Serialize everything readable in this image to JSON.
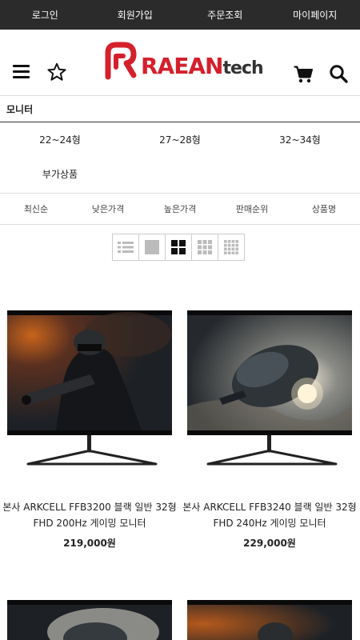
{
  "topbar": {
    "login": "로그인",
    "join": "회원가입",
    "order": "주문조회",
    "mypage": "마이페이지"
  },
  "logo": {
    "main": "RAEAN",
    "sub": "tech"
  },
  "icons": {
    "menu": "hamburger-menu-icon",
    "favorite": "star-icon",
    "cart": "cart-icon",
    "search": "search-icon"
  },
  "category": {
    "title": "모니터",
    "subcategories": [
      "22~24형",
      "27~28형",
      "32~34형",
      "부가상품"
    ]
  },
  "sort": [
    "최신순",
    "낮은가격",
    "높은가격",
    "판매순위",
    "상품명"
  ],
  "views": [
    "list-view",
    "one-column-view",
    "two-column-view",
    "three-column-view",
    "four-column-view"
  ],
  "products": [
    {
      "name": "본사 ARKCELL FFB3200 블랙 일반 32형 FHD 200Hz 게이밍 모니터",
      "price": "219,000원"
    },
    {
      "name": "본사 ARKCELL FFB3240 블랙 일반 32형 FHD 240Hz 게이밍 모니터",
      "price": "229,000원"
    }
  ],
  "colors": {
    "brand": "#d4202c",
    "topbar": "#2b2b2b"
  }
}
